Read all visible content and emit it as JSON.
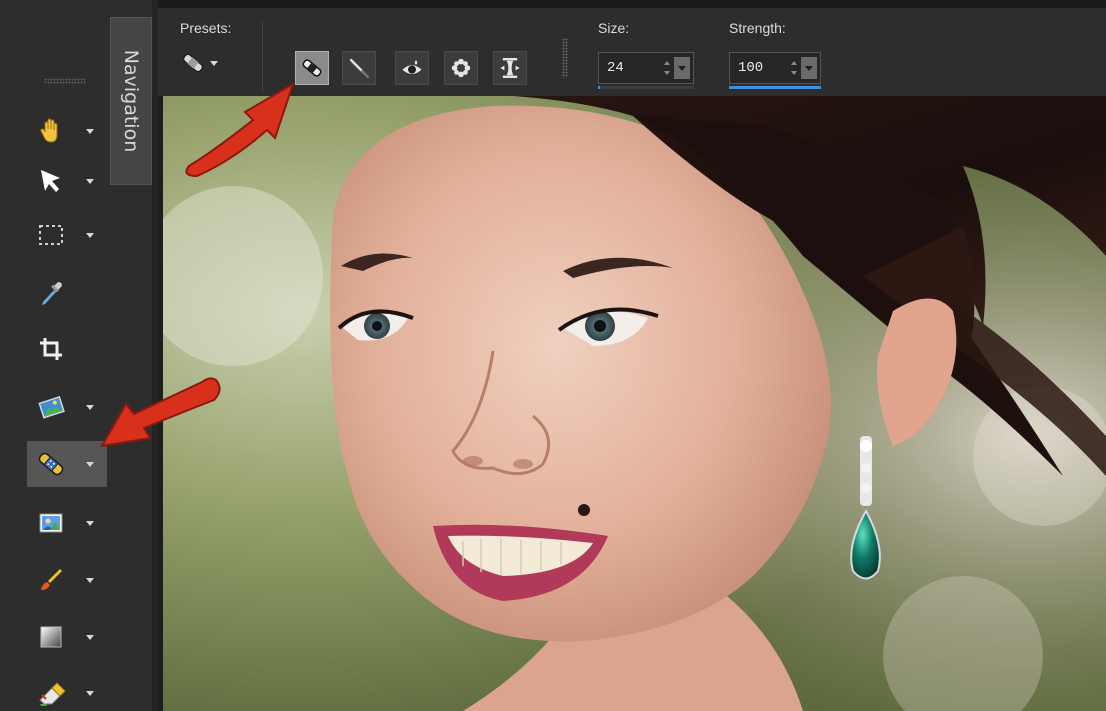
{
  "left_panel": {
    "navigation_tab_label": "Navigation",
    "tools": [
      {
        "name": "pan-tool",
        "icon": "hand-icon"
      },
      {
        "name": "pick-tool",
        "icon": "arrow-pointer-icon"
      },
      {
        "name": "selection-tool",
        "icon": "dashed-rectangle-icon"
      },
      {
        "name": "dropper-tool",
        "icon": "eyedropper-icon"
      },
      {
        "name": "crop-tool",
        "icon": "crop-icon"
      },
      {
        "name": "straighten-tool",
        "icon": "image-adjust-icon"
      },
      {
        "name": "blemish-remover-tool",
        "icon": "bandage-icon",
        "active": true
      },
      {
        "name": "clone-tool",
        "icon": "portrait-icon"
      },
      {
        "name": "paint-brush-tool",
        "icon": "paint-brush-icon"
      },
      {
        "name": "fill-tool",
        "icon": "gradient-icon"
      },
      {
        "name": "eraser-tool",
        "icon": "eraser-icon"
      }
    ]
  },
  "options_bar": {
    "presets_label": "Presets:",
    "presets_icon": "bandage-icon",
    "mode_buttons": [
      {
        "name": "blemish-fixer",
        "icon": "bandage-icon",
        "active": true
      },
      {
        "name": "toothbrush",
        "icon": "toothbrush-icon",
        "active": false
      },
      {
        "name": "eye-drop",
        "icon": "eye-icon",
        "active": false
      },
      {
        "name": "skin-smoothing",
        "icon": "flower-icon",
        "active": false
      },
      {
        "name": "thinify",
        "icon": "thinify-icon",
        "active": false
      }
    ],
    "size": {
      "label": "Size:",
      "value": "24",
      "level_fraction": 0.02
    },
    "strength": {
      "label": "Strength:",
      "value": "100",
      "level_fraction": 1.0
    }
  },
  "annotations": {
    "arrow_color": "#d9301c"
  }
}
